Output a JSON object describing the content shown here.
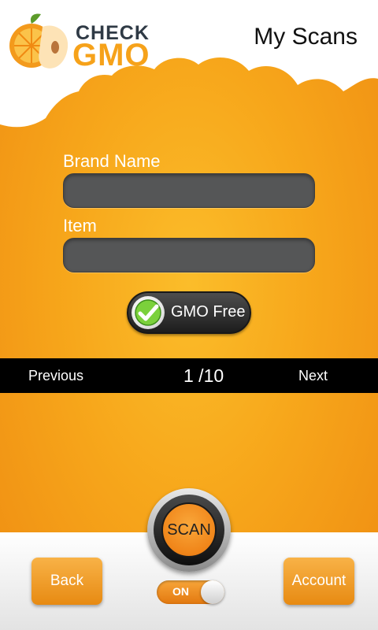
{
  "header": {
    "logo_check": "CHECK",
    "logo_gmo": "GMO",
    "title": "My Scans"
  },
  "form": {
    "brand_label": "Brand Name",
    "brand_value": "",
    "item_label": "Item",
    "item_value": "",
    "gmo_toggle_label": "GMO Free"
  },
  "pager": {
    "previous": "Previous",
    "page_indicator": "1  /10",
    "next": "Next"
  },
  "footer": {
    "back": "Back",
    "scan": "SCAN",
    "toggle_state": "ON",
    "account": "Account"
  },
  "colors": {
    "accent": "#f7a71b",
    "field": "#555657",
    "pager_bg": "#000000"
  }
}
